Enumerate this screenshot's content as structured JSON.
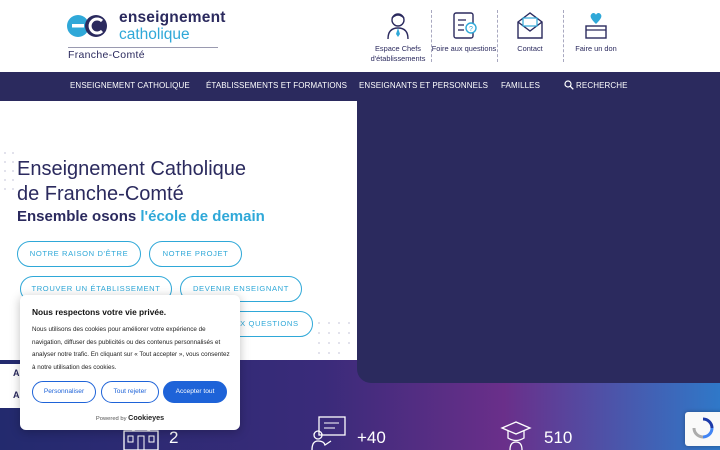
{
  "brand": {
    "line1": "enseignement",
    "line2": "catholique",
    "region": "Franche-Comté",
    "colors": {
      "primary": "#2b2a5e",
      "accent": "#2fa8d8"
    }
  },
  "quick_links": [
    {
      "label": "Espace Chefs d'établissements",
      "icon": "school-director-icon"
    },
    {
      "label": "Foire aux questions",
      "icon": "faq-clipboard-icon"
    },
    {
      "label": "Contact",
      "icon": "envelope-icon"
    },
    {
      "label": "Faire un don",
      "icon": "donation-box-icon"
    }
  ],
  "nav": {
    "items": [
      "ENSEIGNEMENT CATHOLIQUE",
      "ÉTABLISSEMENTS ET FORMATIONS",
      "ENSEIGNANTS ET PERSONNELS",
      "FAMILLES"
    ],
    "search_label": "RECHERCHE"
  },
  "hero": {
    "title_line1": "Enseignement Catholique",
    "title_line2": "de Franche-Comté",
    "subtitle_part1": "Ensemble osons ",
    "subtitle_part2": "l'école de demain",
    "buttons": [
      "NOTRE RAISON D'ÊTRE",
      "NOTRE PROJET",
      "TROUVER UN ÉTABLISSEMENT",
      "DEVENIR ENSEIGNANT",
      "AUX QUESTIONS"
    ]
  },
  "stats": [
    {
      "value": "2",
      "icon": "building-icon"
    },
    {
      "value": "+40",
      "icon": "teacher-board-icon"
    },
    {
      "value": "510",
      "icon": "graduation-cap-icon"
    }
  ],
  "side_tabs": [
    "A",
    "A"
  ],
  "cookie": {
    "title": "Nous respectons votre vie privée.",
    "text": "Nous utilisons des cookies pour améliorer votre expérience de navigation, diffuser des publicités ou des contenus personnalisés et analyser notre trafic. En cliquant sur « Tout accepter », vous consentez à notre utilisation des cookies.",
    "btn_customize": "Personnaliser",
    "btn_reject": "Tout rejeter",
    "btn_accept": "Accepter tout",
    "powered_by": "Powered by",
    "powered_brand": "Cookieyes"
  }
}
